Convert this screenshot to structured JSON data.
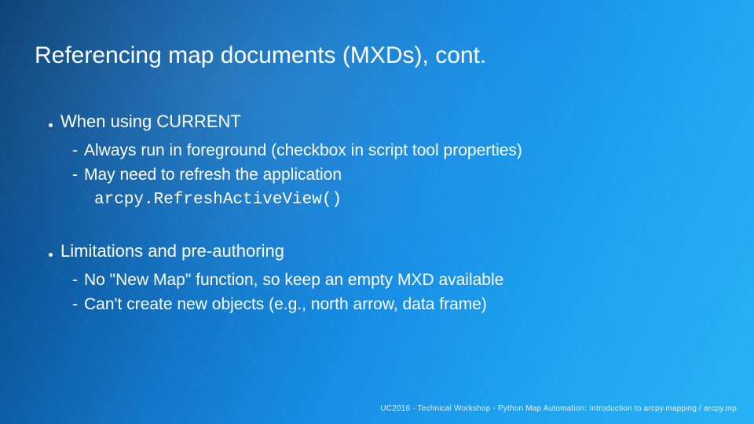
{
  "slide": {
    "title": "Referencing map documents (MXDs), cont.",
    "blocks": [
      {
        "heading": "When using CURRENT",
        "subs": [
          {
            "text": "Always run in foreground (checkbox in script tool properties)"
          },
          {
            "text": "May need to refresh the application"
          }
        ],
        "code": "arcpy.RefreshActiveView()"
      },
      {
        "heading": "Limitations and pre-authoring",
        "subs": [
          {
            "text": "No \"New Map\" function, so keep an empty MXD available"
          },
          {
            "text": "Can't create new objects (e.g., north arrow, data frame)"
          }
        ]
      }
    ],
    "footer": "UC2016 - Technical Workshop - Python Map Automation: Introduction to arcpy.mapping / arcpy.mp"
  }
}
